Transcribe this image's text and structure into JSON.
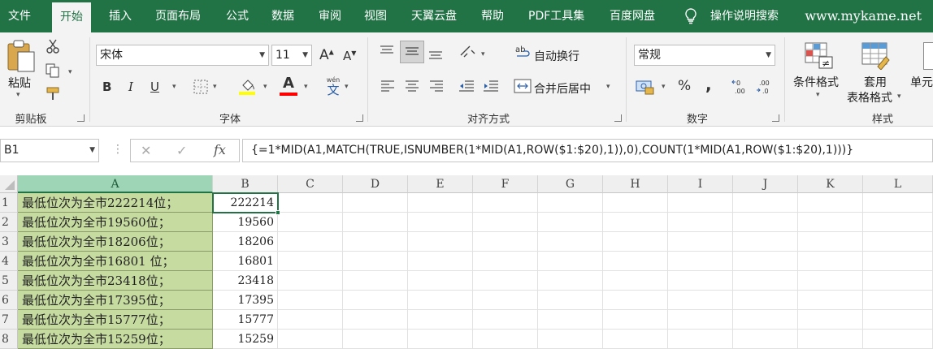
{
  "menu": {
    "items": [
      "文件",
      "开始",
      "插入",
      "页面布局",
      "公式",
      "数据",
      "审阅",
      "视图",
      "天翼云盘",
      "帮助",
      "PDF工具集",
      "百度网盘"
    ],
    "active": "开始",
    "tell_me": "操作说明搜索",
    "watermark": "www.mykame.net"
  },
  "ribbon": {
    "clipboard": {
      "paste": "粘贴",
      "group": "剪贴板"
    },
    "font": {
      "name": "宋体",
      "size": "11",
      "bold": "B",
      "italic": "I",
      "underline": "U",
      "grow": "A",
      "shrink": "A",
      "font_color": "A",
      "phonetic": "wén",
      "phonetic_char": "文",
      "group": "字体",
      "fill_color_hex": "#ffff00",
      "font_color_hex": "#ff0000"
    },
    "alignment": {
      "wrap": "自动换行",
      "merge": "合并后居中",
      "group": "对齐方式"
    },
    "number": {
      "format": "常规",
      "percent": "%",
      "comma": ",",
      "group": "数字"
    },
    "styles": {
      "conditional": "条件格式",
      "table_format_1": "套用",
      "table_format_2": "表格格式",
      "cell_styles": "单元",
      "group": "样式"
    }
  },
  "formula_bar": {
    "name_box": "B1",
    "fx": "fx",
    "formula": "{=1*MID(A1,MATCH(TRUE,ISNUMBER(1*MID(A1,ROW($1:$20),1)),0),COUNT(1*MID(A1,ROW($1:$20),1)))}"
  },
  "sheet": {
    "columns": [
      "A",
      "B",
      "C",
      "D",
      "E",
      "F",
      "G",
      "H",
      "I",
      "J",
      "K",
      "L"
    ],
    "rows": [
      {
        "n": "1",
        "a": "最低位次为全市222214位；",
        "b": "222214"
      },
      {
        "n": "2",
        "a": "最低位次为全市19560位；",
        "b": "19560"
      },
      {
        "n": "3",
        "a": "最低位次为全市18206位；",
        "b": "18206"
      },
      {
        "n": "4",
        "a": "最低位次为全市16801 位；",
        "b": "16801"
      },
      {
        "n": "5",
        "a": "最低位次为全市23418位；",
        "b": "23418"
      },
      {
        "n": "6",
        "a": "最低位次为全市17395位；",
        "b": "17395"
      },
      {
        "n": "7",
        "a": "最低位次为全市15777位；",
        "b": "15777"
      },
      {
        "n": "8",
        "a": "最低位次为全市15259位；",
        "b": "15259"
      }
    ]
  }
}
